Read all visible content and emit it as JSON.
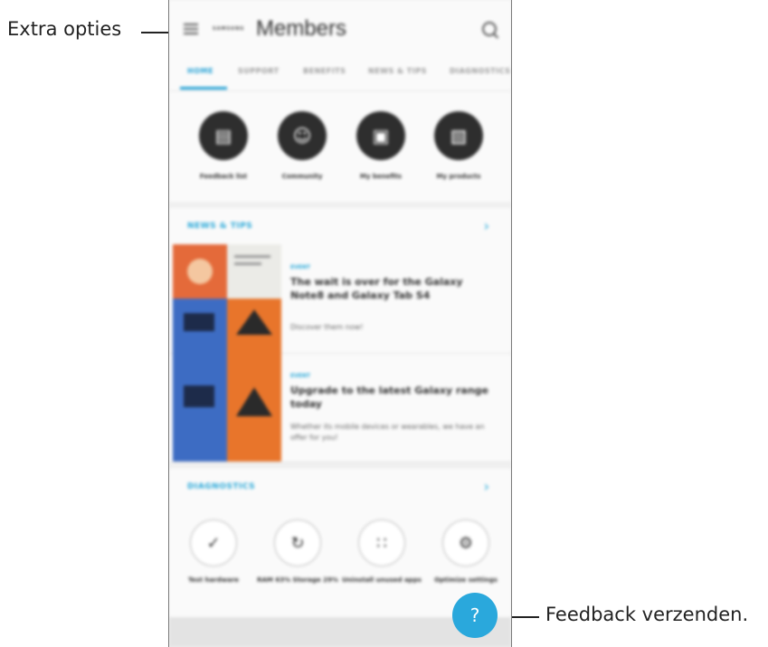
{
  "callouts": {
    "left": "Extra opties",
    "right": "Feedback verzenden."
  },
  "app": {
    "brand": "SAMSUNG",
    "title": "Members",
    "menu_icon": "hamburger-menu-icon",
    "search_icon": "search-icon"
  },
  "tabs": [
    "HOME",
    "SUPPORT",
    "BENEFITS",
    "NEWS & TIPS",
    "DIAGNOSTICS"
  ],
  "quick_actions": [
    {
      "label": "Feedback list",
      "icon": "document-icon"
    },
    {
      "label": "Community",
      "icon": "community-icon"
    },
    {
      "label": "My benefits",
      "icon": "gift-icon"
    },
    {
      "label": "My products",
      "icon": "devices-icon"
    }
  ],
  "news_section": {
    "title": "NEWS & TIPS",
    "items": [
      {
        "category": "EVENT",
        "title": "The wait is over for the Galaxy Note8 and Galaxy Tab S4",
        "body": "Discover them now!"
      },
      {
        "category": "EVENT",
        "title": "Upgrade to the latest Galaxy range today",
        "body": "Whether its mobile devices or wearables, we have an offer for you!"
      }
    ]
  },
  "diagnostics_section": {
    "title": "DIAGNOSTICS",
    "items": [
      {
        "label": "Test hardware",
        "icon": "check-icon"
      },
      {
        "label": "RAM 63% Storage 29%",
        "icon": "refresh-icon"
      },
      {
        "label": "Uninstall unused apps",
        "icon": "apps-icon"
      },
      {
        "label": "Optimize settings",
        "icon": "settings-gear-icon"
      }
    ]
  },
  "feedback_button": "?",
  "colors": {
    "accent": "#2aa8dc",
    "dark_circle": "#2e2e2e"
  }
}
